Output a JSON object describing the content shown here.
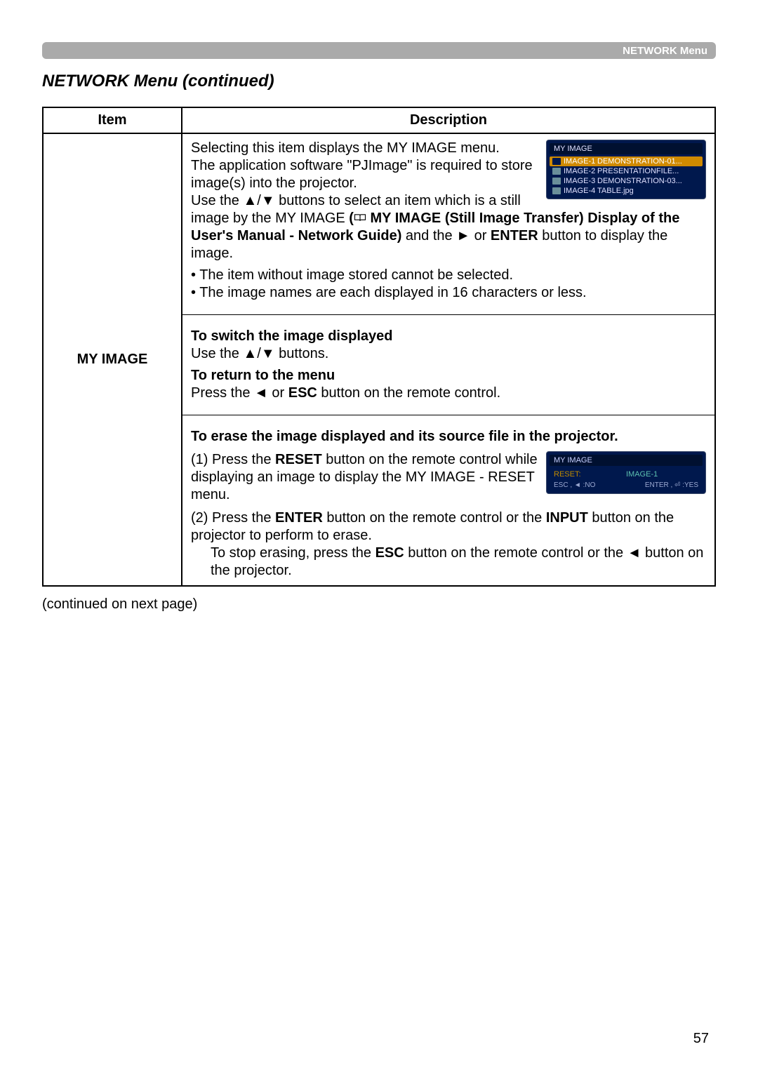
{
  "header": {
    "tab": "NETWORK Menu"
  },
  "section_title": "NETWORK Menu (continued)",
  "table": {
    "headers": {
      "item": "Item",
      "description": "Description"
    },
    "row": {
      "item": "MY IMAGE",
      "desc": {
        "p1": "Selecting this item displays the MY IMAGE menu.",
        "p2": "The application software \"PJImage\" is required to store image(s) into the projector.",
        "p3a": "Use the ▲/▼ buttons to select an item which is a still image by the MY IMAGE ",
        "p3b": "(",
        "p3c": " MY IMAGE (Still Image Transfer) Display of the User's Manual - Network Guide)",
        "p3d": " and the ► or ",
        "p3e": "ENTER",
        "p3f": " button to display the image.",
        "bul1": "• The item without image stored cannot be selected.",
        "bul2": "• The image names are each displayed in 16 characters or less.",
        "h1": "To switch the image displayed",
        "h1_body": "Use the ▲/▼ buttons.",
        "h2": "To return to the menu",
        "h2_body_a": "Press the ◄ or ",
        "h2_body_b": "ESC",
        "h2_body_c": " button on the remote control.",
        "h3": "To erase the image displayed and its source file in the projector.",
        "s1a": "(1) Press the ",
        "s1b": "RESET",
        "s1c": " button on the remote control while displaying an image to display the MY IMAGE - RESET menu.",
        "s2a": "(2) Press the ",
        "s2b": "ENTER",
        "s2c": " button on the remote control or the ",
        "s2d": "INPUT",
        "s2e": " button on the projector to perform to erase.",
        "s2f": "To stop erasing, press the ",
        "s2g": "ESC",
        "s2h": " button on the remote control or the ◄ button on the projector."
      }
    }
  },
  "osd1": {
    "title": "MY IMAGE",
    "rows": [
      {
        "left": "IMAGE-1",
        "right": "DEMONSTRATION-01...",
        "sel": true
      },
      {
        "left": "IMAGE-2",
        "right": "PRESENTATIONFILE...",
        "sel": false
      },
      {
        "left": "IMAGE-3",
        "right": "DEMONSTRATION-03...",
        "sel": false
      },
      {
        "left": "IMAGE-4",
        "right": "TABLE.jpg",
        "sel": false
      }
    ]
  },
  "osd2": {
    "title": "MY IMAGE",
    "reset_label": "RESET:",
    "reset_value": "IMAGE-1",
    "foot_left": "ESC , ◄ :NO",
    "foot_right": "ENTER , ⏎ :YES"
  },
  "continued": "(continued on next page)",
  "pagenum": "57"
}
